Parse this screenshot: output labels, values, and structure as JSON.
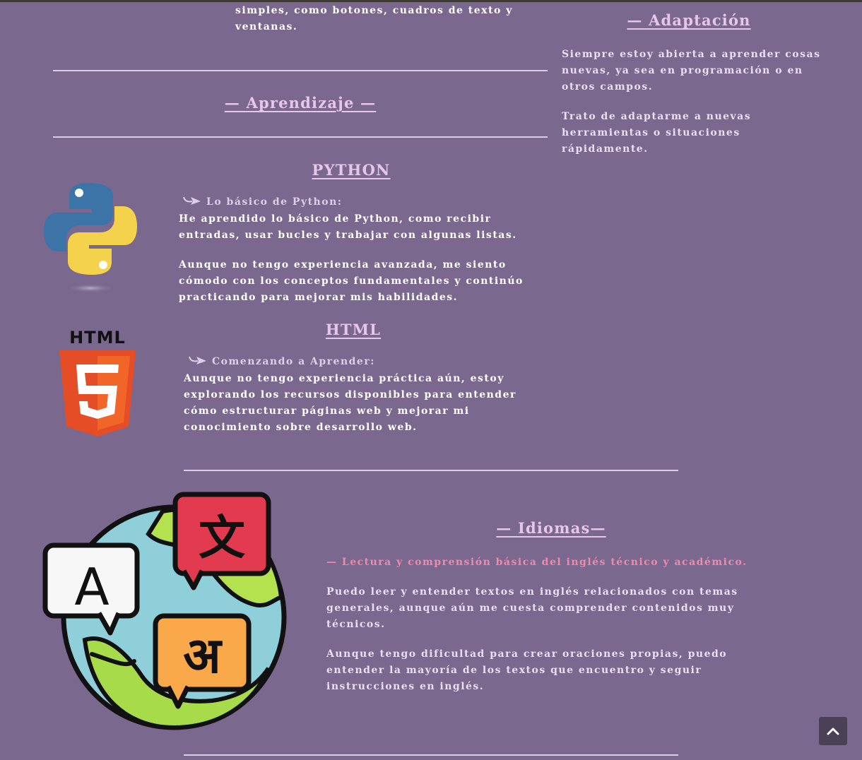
{
  "intro_tail": "simples, como botones, cuadros de texto y ventanas.",
  "adaptacion": {
    "title": "— Adaptación",
    "p1": "Siempre estoy abierta a aprender cosas nuevas, ya sea en programación o en otros campos.",
    "p2": "Trato de adaptarme a nuevas herramientas o situaciones rápidamente."
  },
  "aprendizaje": {
    "title": "— Aprendizaje —"
  },
  "python": {
    "title": "PYTHON",
    "subtitle": "Lo básico de Python:",
    "p1": "He aprendido lo básico de Python, como recibir entradas, usar bucles y trabajar con algunas listas.",
    "p2": "Aunque no tengo experiencia avanzada, me siento cómodo con los conceptos fundamentales y continúo practicando para mejorar mis habilidades."
  },
  "html": {
    "logo_text": "HTML",
    "title": "HTML",
    "subtitle": "Comenzando a Aprender:",
    "p1": "Aunque no tengo experiencia práctica aún, estoy explorando los recursos disponibles para entender cómo estructurar páginas web y mejorar mi conocimiento sobre desarrollo web."
  },
  "idiomas": {
    "title": "— Idiomas—",
    "highlight": "— Lectura y comprensión básica del inglés técnico y académico.",
    "p1": "Puedo leer y entender textos en inglés relacionados con temas generales, aunque aún me cuesta comprender contenidos muy técnicos.",
    "p2": "Aunque tengo dificultad para crear oraciones propias, puedo entender la mayoría de los textos que encuentro y seguir instrucciones en inglés.",
    "glyph_a": "A",
    "glyph_zh": "文",
    "glyph_hi": "अ"
  },
  "colors": {
    "background": "#7b688f",
    "heading": "#e8c6ea",
    "highlight": "#f08aa8",
    "rule": "#d7cfe4"
  },
  "icons": {
    "arrow": "curved-arrow-icon",
    "back_to_top": "chevron-up-icon"
  }
}
